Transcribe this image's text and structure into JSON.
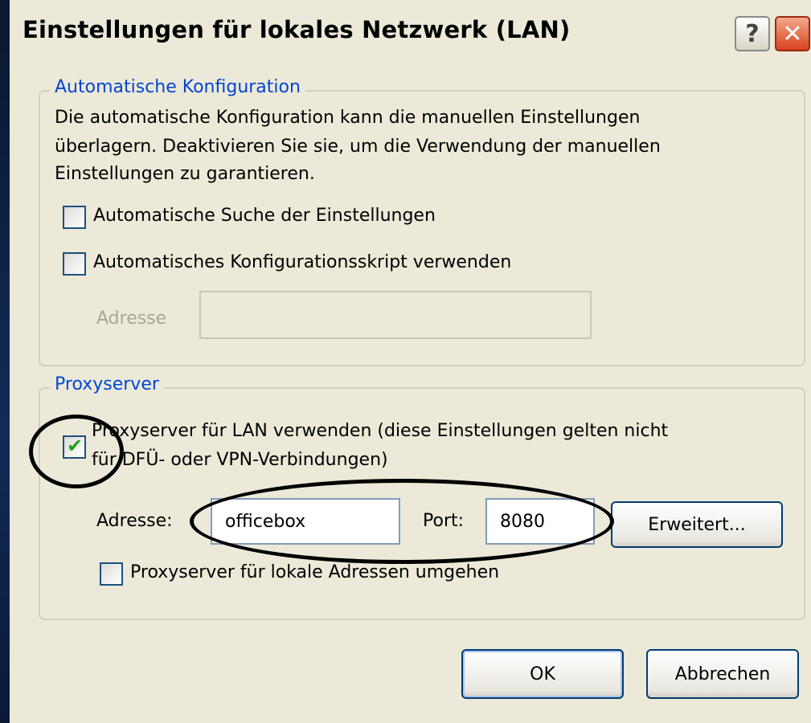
{
  "dialog": {
    "title": "Einstellungen für lokales Netzwerk (LAN)",
    "help_button": "?",
    "close_button": "✕"
  },
  "auto_config": {
    "legend": "Automatische Konfiguration",
    "description_lines": [
      "Die automatische Konfiguration kann die manuellen Einstellungen",
      "überlagern. Deaktivieren Sie sie, um die Verwendung der manuellen",
      "Einstellungen zu garantieren."
    ],
    "auto_detect": {
      "label": "Automatische Suche der Einstellungen",
      "checked": false
    },
    "auto_script": {
      "label": "Automatisches Konfigurationsskript verwenden",
      "checked": false
    },
    "address_label": "Adresse",
    "address_value": ""
  },
  "proxy": {
    "legend": "Proxyserver",
    "use_proxy": {
      "label_line1": "Proxyserver für LAN verwenden (diese Einstellungen gelten nicht",
      "label_line2": "für DFÜ- oder VPN-Verbindungen)",
      "checked": true
    },
    "address_label": "Adresse:",
    "address_value": "officebox",
    "port_label": "Port:",
    "port_value": "8080",
    "advanced_button": "Erweitert...",
    "bypass_local": {
      "label": "Proxyserver für lokale Adressen umgehen",
      "checked": false
    }
  },
  "footer": {
    "ok_button": "OK",
    "cancel_button": "Abbrechen"
  },
  "colors": {
    "dialog_bg": "#ece9d8",
    "legend_text": "#0046d5",
    "check_green": "#21a121",
    "disabled_text": "#a7a596"
  }
}
